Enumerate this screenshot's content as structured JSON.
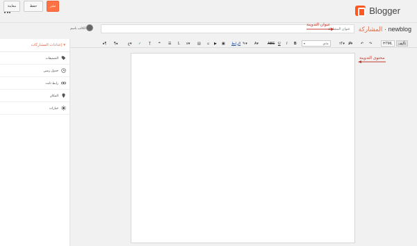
{
  "app": {
    "brand": "Blogger",
    "brand_color": "#ff5722"
  },
  "breadcrumb": {
    "blog": "newblog",
    "separator": "·",
    "section": "المشاركة"
  },
  "title_field": {
    "placeholder": "عنوان المشاركة",
    "value": ""
  },
  "annotations": {
    "title_label": "عنوان التدوينة",
    "content_label": "محتوى التدوينة",
    "color": "#c0392b"
  },
  "author": {
    "name": "الكاتب باسم"
  },
  "actions": {
    "publish_label": "نشر",
    "save_label": "حفظ",
    "preview_label": "معاينة"
  },
  "toolbar": {
    "compose_label": "تأليف",
    "html_label": "HTML",
    "font_value": "عادي",
    "icons": [
      "undo-icon",
      "redo-icon",
      "font-icon",
      "font-size-icon",
      "bold-icon",
      "italic-icon",
      "underline-icon",
      "strikethrough-icon",
      "text-color-icon",
      "highlight-icon",
      "link-icon",
      "image-icon",
      "video-icon",
      "emoji-icon",
      "jump-break-icon",
      "align-icon",
      "numbered-list-icon",
      "bulleted-list-icon",
      "quote-icon",
      "clear-format-icon",
      "spellcheck-icon",
      "rtl-icon",
      "ltr-icon"
    ],
    "link_label": "الرابط"
  },
  "sidebar": {
    "header": "إعدادات المشاركات",
    "items": [
      {
        "label": "التصنيفات",
        "icon": "tag-icon"
      },
      {
        "label": "جدول زمني",
        "icon": "clock-icon"
      },
      {
        "label": "رابط ثابت",
        "icon": "link-icon"
      },
      {
        "label": "المكان",
        "icon": "location-pin-icon"
      },
      {
        "label": "خيارات",
        "icon": "gear-icon"
      }
    ]
  }
}
